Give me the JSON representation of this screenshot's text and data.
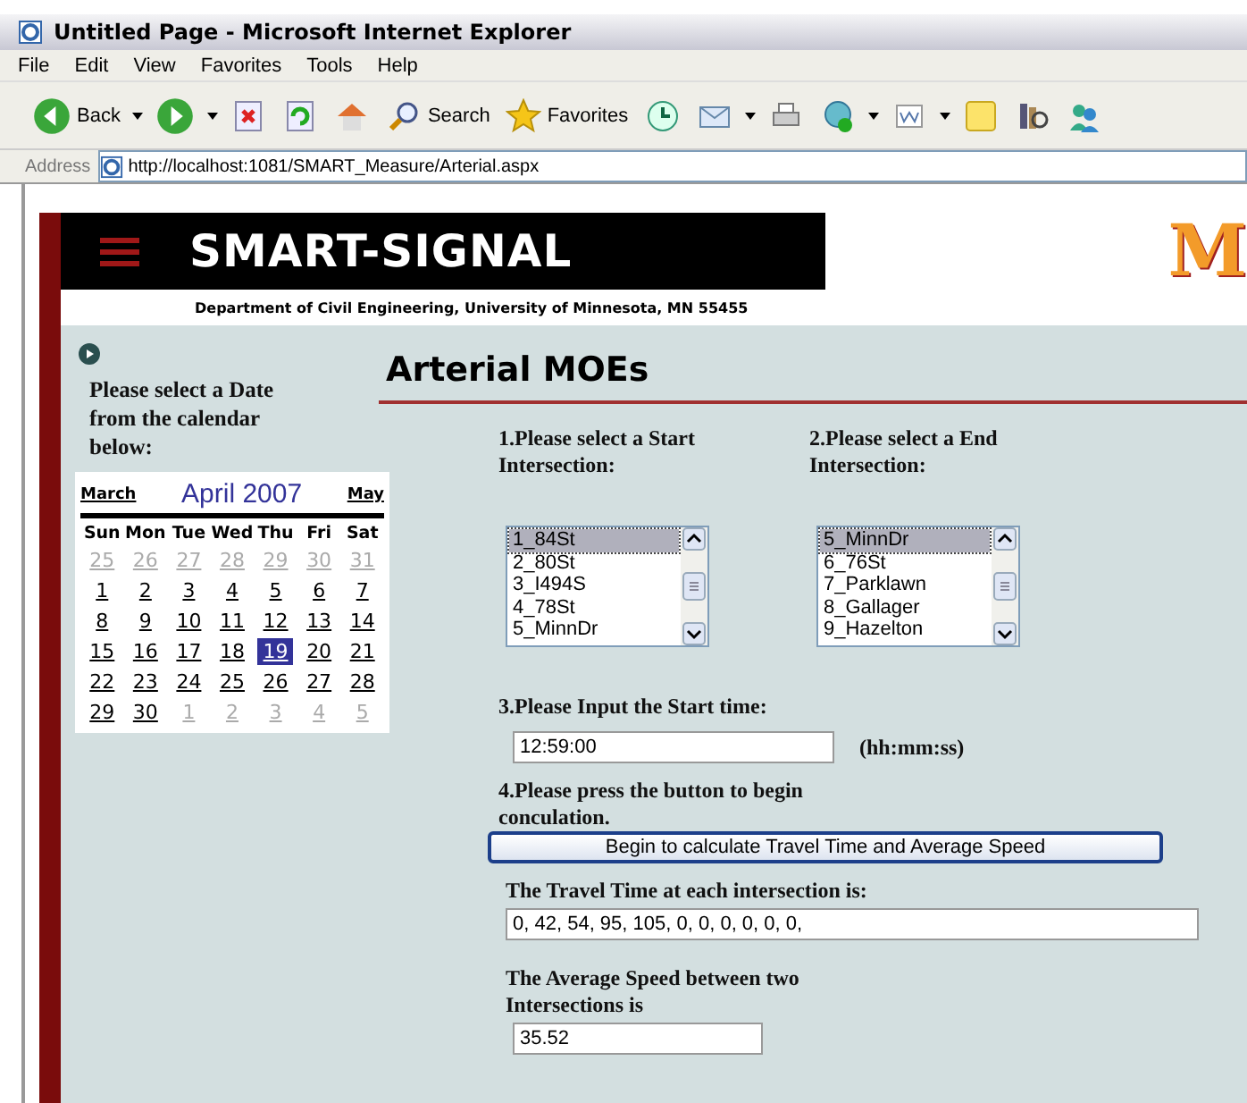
{
  "window": {
    "title": "Untitled Page - Microsoft Internet Explorer"
  },
  "menu": [
    "File",
    "Edit",
    "View",
    "Favorites",
    "Tools",
    "Help"
  ],
  "toolbar": [
    {
      "kind": "back",
      "label": "Back"
    },
    {
      "kind": "forward"
    },
    {
      "kind": "stop"
    },
    {
      "kind": "refresh"
    },
    {
      "kind": "home"
    },
    {
      "kind": "search",
      "label": "Search"
    },
    {
      "kind": "favorites",
      "label": "Favorites"
    },
    {
      "kind": "history"
    },
    {
      "kind": "mail"
    },
    {
      "kind": "print"
    },
    {
      "kind": "messenger"
    },
    {
      "kind": "word"
    },
    {
      "kind": "note"
    },
    {
      "kind": "research"
    },
    {
      "kind": "people"
    }
  ],
  "address": {
    "label": "Address",
    "url": "http://localhost:1081/SMART_Measure/Arterial.aspx"
  },
  "header": {
    "title": "SMART-SIGNAL",
    "subtitle": "Department of Civil Engineering, University of Minnesota, MN 55455",
    "logo": "M"
  },
  "sidebar": {
    "prompt": "Please select a Date from the calendar below:"
  },
  "calendar": {
    "prev": "March",
    "month": "April 2007",
    "next": "May",
    "weekdays": [
      "Sun",
      "Mon",
      "Tue",
      "Wed",
      "Thu",
      "Fri",
      "Sat"
    ],
    "weeks": [
      [
        {
          "day": "25",
          "other": true,
          "selected": false
        },
        {
          "day": "26",
          "other": true,
          "selected": false
        },
        {
          "day": "27",
          "other": true,
          "selected": false
        },
        {
          "day": "28",
          "other": true,
          "selected": false
        },
        {
          "day": "29",
          "other": true,
          "selected": false
        },
        {
          "day": "30",
          "other": true,
          "selected": false
        },
        {
          "day": "31",
          "other": true,
          "selected": false
        }
      ],
      [
        {
          "day": "1",
          "other": false,
          "selected": false
        },
        {
          "day": "2",
          "other": false,
          "selected": false
        },
        {
          "day": "3",
          "other": false,
          "selected": false
        },
        {
          "day": "4",
          "other": false,
          "selected": false
        },
        {
          "day": "5",
          "other": false,
          "selected": false
        },
        {
          "day": "6",
          "other": false,
          "selected": false
        },
        {
          "day": "7",
          "other": false,
          "selected": false
        }
      ],
      [
        {
          "day": "8",
          "other": false,
          "selected": false
        },
        {
          "day": "9",
          "other": false,
          "selected": false
        },
        {
          "day": "10",
          "other": false,
          "selected": false
        },
        {
          "day": "11",
          "other": false,
          "selected": false
        },
        {
          "day": "12",
          "other": false,
          "selected": false
        },
        {
          "day": "13",
          "other": false,
          "selected": false
        },
        {
          "day": "14",
          "other": false,
          "selected": false
        }
      ],
      [
        {
          "day": "15",
          "other": false,
          "selected": false
        },
        {
          "day": "16",
          "other": false,
          "selected": false
        },
        {
          "day": "17",
          "other": false,
          "selected": false
        },
        {
          "day": "18",
          "other": false,
          "selected": false
        },
        {
          "day": "19",
          "other": false,
          "selected": true
        },
        {
          "day": "20",
          "other": false,
          "selected": false
        },
        {
          "day": "21",
          "other": false,
          "selected": false
        }
      ],
      [
        {
          "day": "22",
          "other": false,
          "selected": false
        },
        {
          "day": "23",
          "other": false,
          "selected": false
        },
        {
          "day": "24",
          "other": false,
          "selected": false
        },
        {
          "day": "25",
          "other": false,
          "selected": false
        },
        {
          "day": "26",
          "other": false,
          "selected": false
        },
        {
          "day": "27",
          "other": false,
          "selected": false
        },
        {
          "day": "28",
          "other": false,
          "selected": false
        }
      ],
      [
        {
          "day": "29",
          "other": false,
          "selected": false
        },
        {
          "day": "30",
          "other": false,
          "selected": false
        },
        {
          "day": "1",
          "other": true,
          "selected": false
        },
        {
          "day": "2",
          "other": true,
          "selected": false
        },
        {
          "day": "3",
          "other": true,
          "selected": false
        },
        {
          "day": "4",
          "other": true,
          "selected": false
        },
        {
          "day": "5",
          "other": true,
          "selected": false
        }
      ]
    ]
  },
  "main": {
    "title": "Arterial MOEs",
    "start": {
      "label": "1.Please select a Start Intersection:",
      "items": [
        {
          "text": "1_84St",
          "selected": true
        },
        {
          "text": "2_80St",
          "selected": false
        },
        {
          "text": "3_I494S",
          "selected": false
        },
        {
          "text": "4_78St",
          "selected": false
        },
        {
          "text": "5_MinnDr",
          "selected": false
        }
      ]
    },
    "end": {
      "label": "2.Please select a End Intersection:",
      "items": [
        {
          "text": "5_MinnDr",
          "selected": true
        },
        {
          "text": "6_76St",
          "selected": false
        },
        {
          "text": "7_Parklawn",
          "selected": false
        },
        {
          "text": "8_Gallager",
          "selected": false
        },
        {
          "text": "9_Hazelton",
          "selected": false
        }
      ]
    },
    "time": {
      "label": "3.Please Input the Start time:",
      "value": "12:59:00",
      "hint": "(hh:mm:ss)"
    },
    "button": {
      "label": "4.Please press the button to begin conculation.",
      "text": "Begin to calculate Travel Time and Average Speed"
    },
    "travel": {
      "label": "The Travel Time at each intersection is:",
      "value": "0, 42, 54, 95, 105, 0, 0, 0, 0, 0, 0,"
    },
    "speed": {
      "label": "The Average Speed between  two Intersections is",
      "value": "35.52"
    }
  }
}
